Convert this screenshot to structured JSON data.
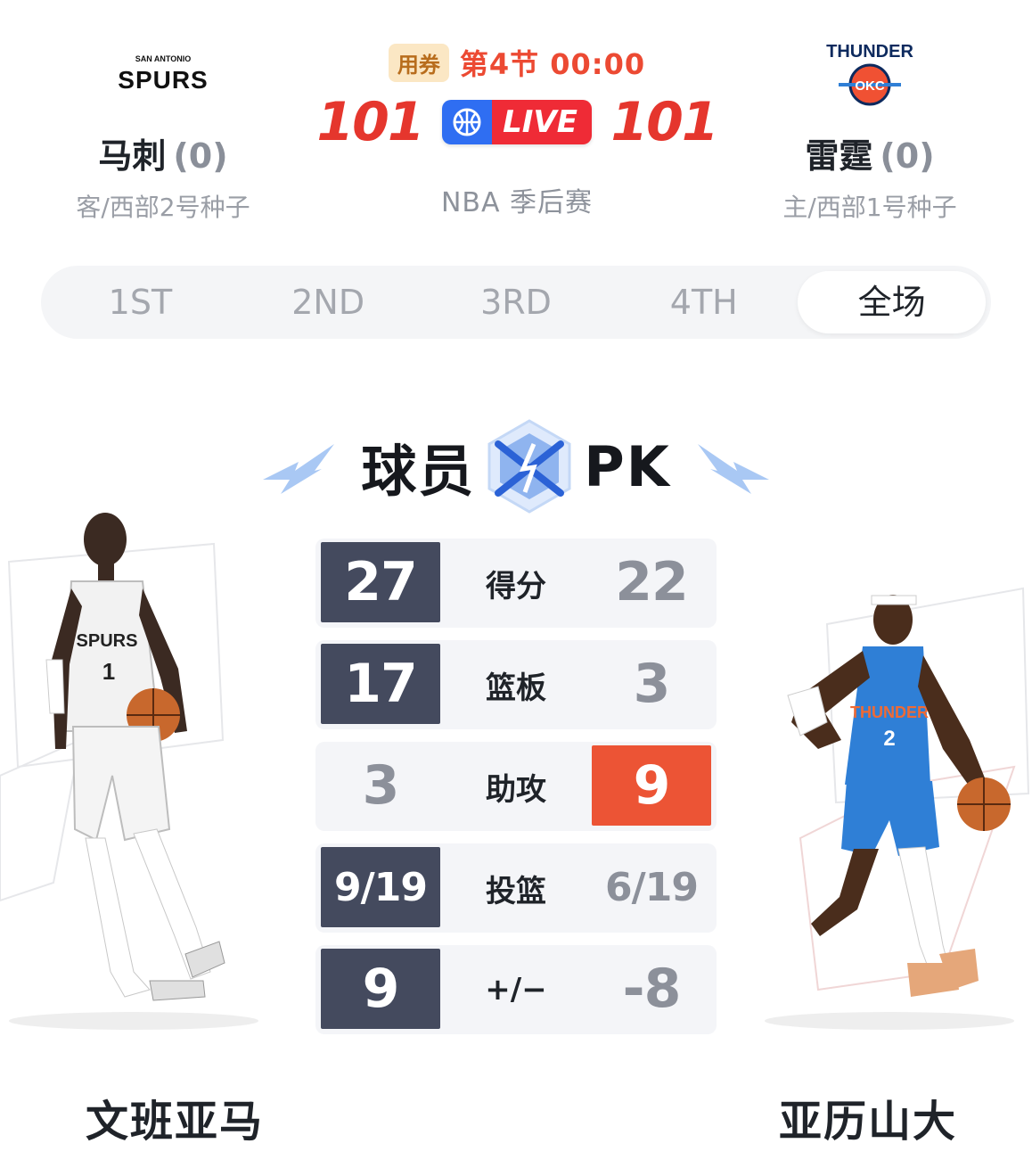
{
  "header": {
    "away": {
      "logo_text_top": "SAN ANTONIO",
      "logo_text": "SPURS",
      "name": "马刺",
      "record": "(0)",
      "sub": "客/西部2号种子"
    },
    "home": {
      "logo_text_top": "THUNDER",
      "logo_text": "OKC",
      "name": "雷霆",
      "record": "(0)",
      "sub": "主/西部1号种子"
    },
    "coupon": "用券",
    "period": "第4节 00:00",
    "away_score": "101",
    "home_score": "101",
    "live": "LIVE",
    "league": "NBA 季后赛"
  },
  "tabs": [
    {
      "label": "1ST",
      "active": false
    },
    {
      "label": "2ND",
      "active": false
    },
    {
      "label": "3RD",
      "active": false
    },
    {
      "label": "4TH",
      "active": false
    },
    {
      "label": "全场",
      "active": true
    }
  ],
  "pk": {
    "left": "球员",
    "right": "PK"
  },
  "stats": [
    {
      "label": "得分",
      "left": "27",
      "right": "22",
      "leader": "left"
    },
    {
      "label": "篮板",
      "left": "17",
      "right": "3",
      "leader": "left"
    },
    {
      "label": "助攻",
      "left": "3",
      "right": "9",
      "leader": "right"
    },
    {
      "label": "投篮",
      "left": "9/19",
      "right": "6/19",
      "leader": "left"
    },
    {
      "label": "+/−",
      "left": "9",
      "right": "-8",
      "leader": "left"
    }
  ],
  "players": {
    "left": {
      "name": "文班亚马",
      "jersey_text": "SPURS",
      "number": "1"
    },
    "right": {
      "name": "亚历山大",
      "jersey_text": "THUNDER",
      "number": "2"
    }
  },
  "colors": {
    "score_red": "#e5362d",
    "leader_navy": "#444a5e",
    "leader_orange": "#ec5435",
    "live_blue": "#2f6ef2",
    "live_red": "#ef2b36"
  }
}
